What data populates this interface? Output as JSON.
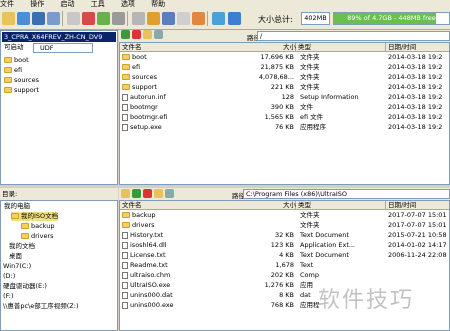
{
  "menu": [
    "文件",
    "操作",
    "启动",
    "工具",
    "选项",
    "帮助"
  ],
  "toolbar": {
    "size_label": "大小总计:",
    "size_value": "402MB",
    "capacity_text": "89% of 4.7GB - 448MB free",
    "capacity_fraction": 0.89
  },
  "top": {
    "iso_name": "3_CPRA_X64FREV_ZH-CN_DV9",
    "boot_label": "可启动",
    "boot_value": "UDF",
    "tree": [
      "boot",
      "efi",
      "sources",
      "support"
    ],
    "path_label": "路径:",
    "path_value": "/",
    "headers": {
      "name": "文件名",
      "size": "大小",
      "type": "类型",
      "date": "日期/时间"
    },
    "files": [
      {
        "name": "boot",
        "size": "17,696 KB",
        "type": "文件夹",
        "date": "2014-03-18 19:2"
      },
      {
        "name": "efi",
        "size": "21,875 KB",
        "type": "文件夹",
        "date": "2014-03-18 19:2"
      },
      {
        "name": "sources",
        "size": "4,078,68...",
        "type": "文件夹",
        "date": "2014-03-18 19:2"
      },
      {
        "name": "support",
        "size": "221 KB",
        "type": "文件夹",
        "date": "2014-03-18 19:2"
      },
      {
        "name": "autorun.inf",
        "size": "128",
        "type": "Setup Information",
        "date": "2014-03-18 19:2"
      },
      {
        "name": "bootmgr",
        "size": "390 KB",
        "type": "文件",
        "date": "2014-03-18 19:2"
      },
      {
        "name": "bootmgr.efi",
        "size": "1,565 KB",
        "type": "efi 文件",
        "date": "2014-03-18 19:2"
      },
      {
        "name": "setup.exe",
        "size": "76 KB",
        "type": "应用程序",
        "date": "2014-03-18 19:2"
      }
    ]
  },
  "bottom": {
    "left_header": "目录:",
    "tree": [
      "我的电脑",
      "我的ISO文档",
      "backup",
      "drivers",
      "我的文档",
      "桌面",
      "Win7(C:)",
      "(D:)",
      "硬盘驱动器(E:)",
      "(F:)",
      "\\\\惠普pc\\e部工序视频(Z:)"
    ],
    "path_label": "路径:",
    "path_value": "C:\\Program Files (x86)\\UltraISO",
    "headers": {
      "name": "文件名",
      "size": "大小",
      "type": "类型",
      "date": "日期/时间"
    },
    "files": [
      {
        "name": "backup",
        "size": "",
        "type": "文件夹",
        "date": "2017-07-07 15:01"
      },
      {
        "name": "drivers",
        "size": "",
        "type": "文件夹",
        "date": "2017-07-07 15:01"
      },
      {
        "name": "History.txt",
        "size": "32 KB",
        "type": "Text Document",
        "date": "2015-07-21 10:58"
      },
      {
        "name": "isoshl64.dll",
        "size": "123 KB",
        "type": "Application Ext...",
        "date": "2014-01-02 14:17"
      },
      {
        "name": "License.txt",
        "size": "4 KB",
        "type": "Text Document",
        "date": "2006-11-24 22:08"
      },
      {
        "name": "Readme.txt",
        "size": "1,678",
        "type": "Text",
        "date": ""
      },
      {
        "name": "ultraiso.chm",
        "size": "202 KB",
        "type": "Comp",
        "date": ""
      },
      {
        "name": "UltraISO.exe",
        "size": "1,276 KB",
        "type": "应用",
        "date": ""
      },
      {
        "name": "unins000.dat",
        "size": "8 KB",
        "type": "dat",
        "date": ""
      },
      {
        "name": "unins000.exe",
        "size": "768 KB",
        "type": "应用程",
        "date": ""
      }
    ]
  },
  "watermark": "软件技巧"
}
